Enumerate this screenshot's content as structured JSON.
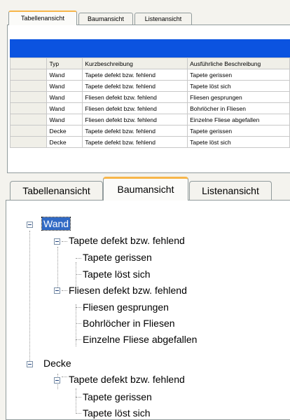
{
  "tabs": [
    {
      "label": "Tabellenansicht"
    },
    {
      "label": "Baumansicht"
    },
    {
      "label": "Listenansicht"
    }
  ],
  "table": {
    "columns": [
      "Typ",
      "Kurzbeschreibung",
      "Ausführliche Beschreibung"
    ],
    "rows": [
      [
        "Wand",
        "Tapete defekt bzw. fehlend",
        "Tapete gerissen"
      ],
      [
        "Wand",
        "Tapete defekt bzw. fehlend",
        "Tapete löst sich"
      ],
      [
        "Wand",
        "Fliesen defekt bzw. fehlend",
        "Fliesen gesprungen"
      ],
      [
        "Wand",
        "Fliesen defekt bzw. fehlend",
        "Bohrlöcher in Fliesen"
      ],
      [
        "Wand",
        "Fliesen defekt bzw. fehlend",
        "Einzelne Fliese abgefallen"
      ],
      [
        "Decke",
        "Tapete defekt bzw. fehlend",
        "Tapete gerissen"
      ],
      [
        "Decke",
        "Tapete defekt bzw. fehlend",
        "Tapete löst sich"
      ]
    ]
  },
  "tree": {
    "nodes": [
      {
        "label": "Wand"
      },
      {
        "label": "Tapete defekt bzw. fehlend"
      },
      {
        "label": "Tapete gerissen"
      },
      {
        "label": "Tapete löst sich"
      },
      {
        "label": "Fliesen defekt bzw. fehlend"
      },
      {
        "label": "Fliesen gesprungen"
      },
      {
        "label": "Bohrlöcher in Fliesen"
      },
      {
        "label": "Einzelne Fliese abgefallen"
      },
      {
        "label": "Decke"
      },
      {
        "label": "Tapete defekt bzw. fehlend"
      },
      {
        "label": "Tapete gerissen"
      },
      {
        "label": "Tapete löst sich"
      }
    ]
  },
  "colors": {
    "selection": "#316ac5",
    "header_blue": "#0b53e0",
    "tab_active_accent": "#f7b64a"
  }
}
